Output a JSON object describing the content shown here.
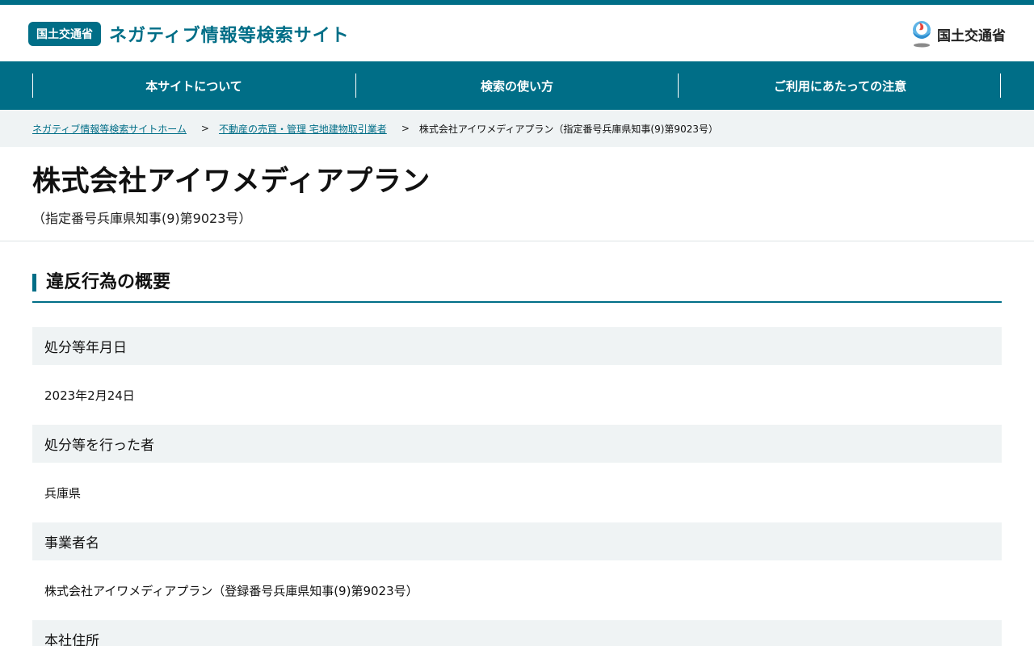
{
  "header": {
    "ministry_badge": "国土交通省",
    "site_title": "ネガティブ情報等検索サイト",
    "mlit_logo_text": "国土交通省"
  },
  "nav": {
    "items": [
      {
        "label": "本サイトについて"
      },
      {
        "label": "検索の使い方"
      },
      {
        "label": "ご利用にあたっての注意"
      }
    ]
  },
  "breadcrumb": {
    "home": "ネガティブ情報等検索サイトホーム",
    "category": "不動産の売買・管理  宅地建物取引業者",
    "current": "株式会社アイワメディアプラン（指定番号兵庫県知事(9)第9023号）",
    "separator": ">"
  },
  "page": {
    "title": "株式会社アイワメディアプラン",
    "subtitle": "（指定番号兵庫県知事(9)第9023号）"
  },
  "section": {
    "title": "違反行為の概要"
  },
  "details": [
    {
      "label": "処分等年月日",
      "value": "2023年2月24日"
    },
    {
      "label": "処分等を行った者",
      "value": "兵庫県"
    },
    {
      "label": "事業者名",
      "value": "株式会社アイワメディアプラン（登録番号兵庫県知事(9)第9023号）"
    },
    {
      "label": "本社住所",
      "value": ""
    }
  ],
  "colors": {
    "primary": "#006e87",
    "label_bg": "#eff3f4"
  }
}
